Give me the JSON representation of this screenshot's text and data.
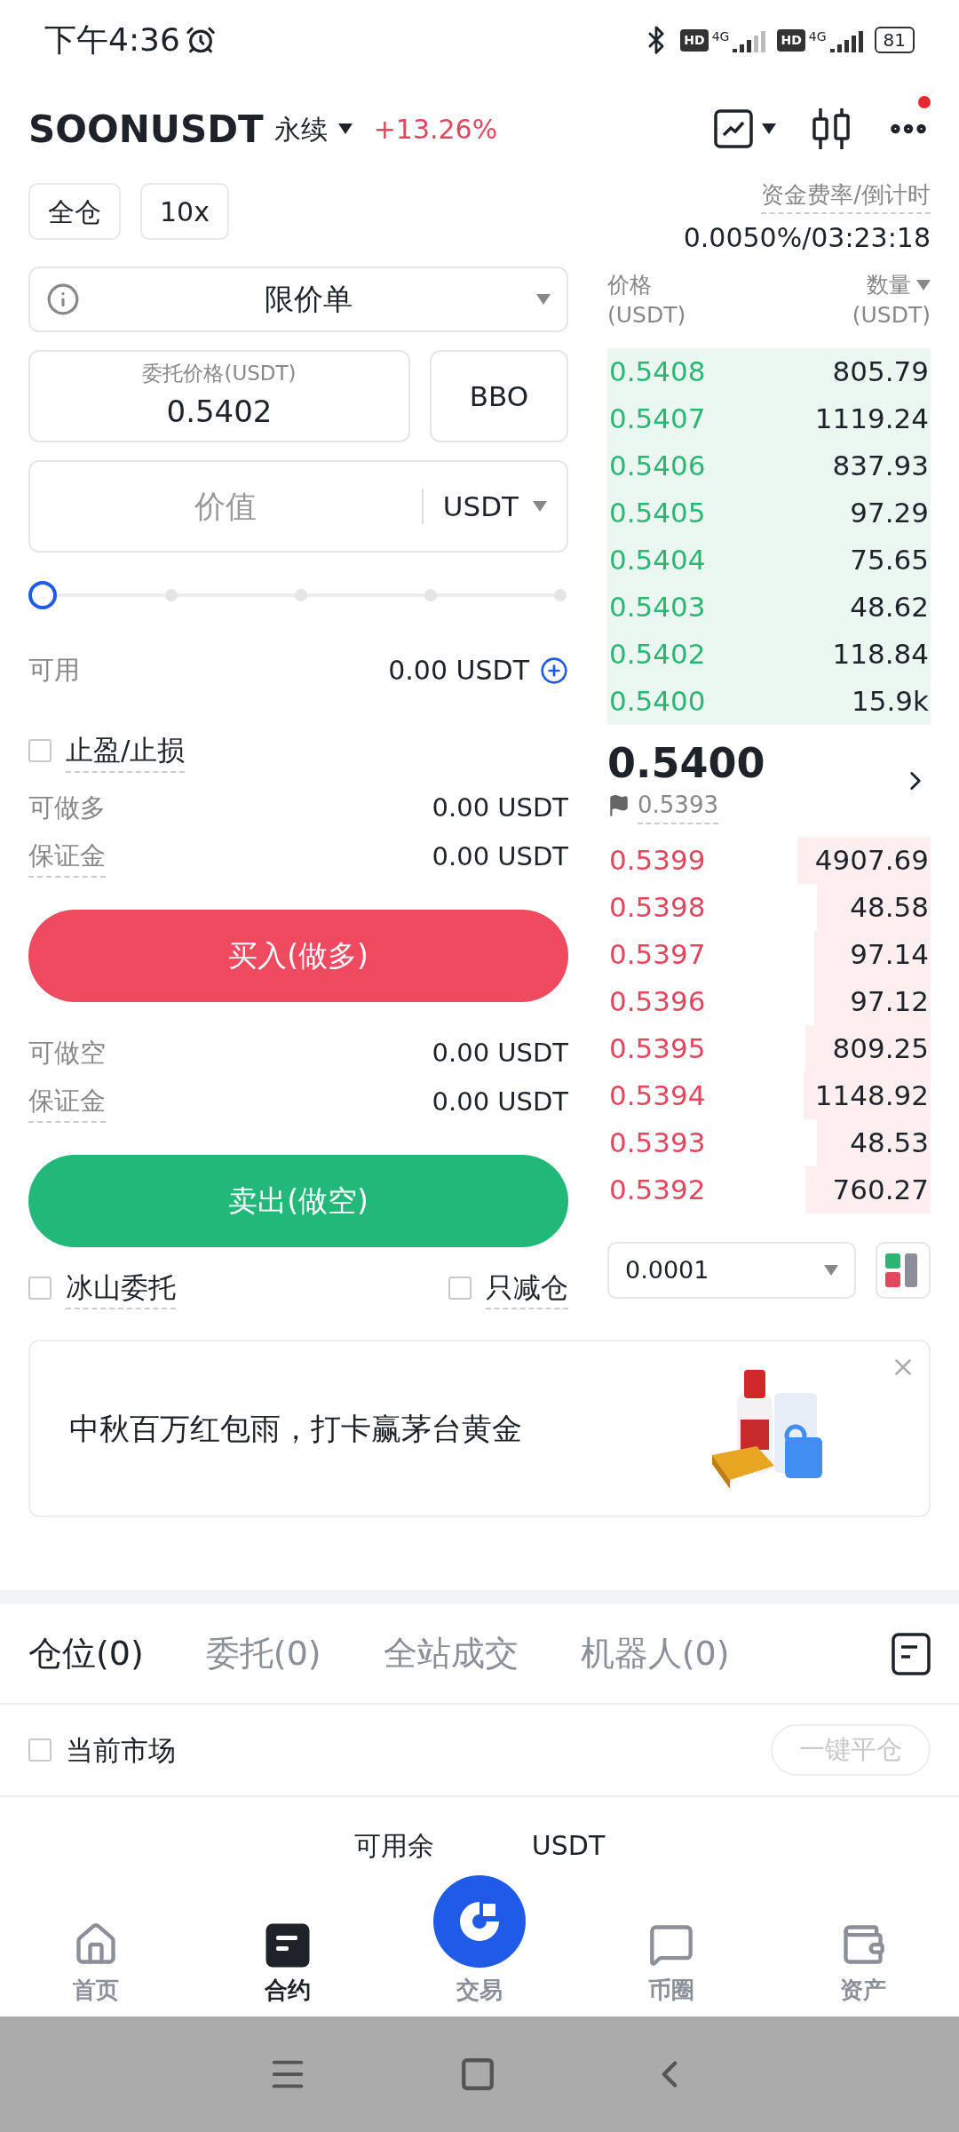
{
  "status_bar": {
    "time": "下午4:36",
    "hd_1": "HD",
    "network_1": "4G",
    "hd_2": "HD",
    "network_2": "4G",
    "battery": "81"
  },
  "header": {
    "symbol": "SOONUSDT",
    "contract_type": "永续",
    "change": "+13.26%",
    "notification_dot": true
  },
  "margin_mode": "全仓",
  "leverage": "10x",
  "funding": {
    "label": "资金费率/倒计时",
    "value": "0.0050%/03:23:18"
  },
  "order_form": {
    "order_type": "限价单",
    "price_label": "委托价格(USDT)",
    "price_value": "0.5402",
    "bbo": "BBO",
    "amount_placeholder": "价值",
    "amount_unit": "USDT",
    "slider": {
      "level": 0
    },
    "available_label": "可用",
    "available_value": "0.00 USDT",
    "tp_sl": {
      "label": "止盈/止损",
      "checked": false
    },
    "long": [
      {
        "label": "可做多",
        "value": "0.00 USDT"
      },
      {
        "label": "保证金",
        "value": "0.00 USDT"
      }
    ],
    "buy_button": "买入(做多)",
    "short": [
      {
        "label": "可做空",
        "value": "0.00 USDT"
      },
      {
        "label": "保证金",
        "value": "0.00 USDT"
      }
    ],
    "sell_button": "卖出(做空)",
    "options": [
      {
        "label": "冰山委托",
        "checked": false
      },
      {
        "label": "只减仓",
        "checked": false
      }
    ]
  },
  "order_book": {
    "price_header": "价格",
    "price_unit": "(USDT)",
    "amount_header": "数量",
    "amount_unit": "(USDT)",
    "asks": [
      {
        "price": "0.5408",
        "amount": "805.79"
      },
      {
        "price": "0.5407",
        "amount": "1119.24"
      },
      {
        "price": "0.5406",
        "amount": "837.93"
      },
      {
        "price": "0.5405",
        "amount": "97.29"
      },
      {
        "price": "0.5404",
        "amount": "75.65"
      },
      {
        "price": "0.5403",
        "amount": "48.62"
      },
      {
        "price": "0.5402",
        "amount": "118.84"
      },
      {
        "price": "0.5400",
        "amount": "15.9k"
      }
    ],
    "last_price": "0.5400",
    "mark_price": "0.5393",
    "bids": [
      {
        "price": "0.5399",
        "amount": "4907.69"
      },
      {
        "price": "0.5398",
        "amount": "48.58"
      },
      {
        "price": "0.5397",
        "amount": "97.14"
      },
      {
        "price": "0.5396",
        "amount": "97.12"
      },
      {
        "price": "0.5395",
        "amount": "809.25"
      },
      {
        "price": "0.5394",
        "amount": "1148.92"
      },
      {
        "price": "0.5393",
        "amount": "48.53"
      },
      {
        "price": "0.5392",
        "amount": "760.27"
      }
    ],
    "precision": "0.0001"
  },
  "banner": {
    "text": "中秋百万红包雨，打卡赢茅台黄金",
    "kind": "picture"
  },
  "tabs": [
    {
      "label": "仓位(0)",
      "selected": true
    },
    {
      "label": "委托(0)",
      "selected": false
    },
    {
      "label": "全站成交",
      "selected": false
    },
    {
      "label": "机器人(0)",
      "selected": false
    }
  ],
  "filter": {
    "label": "当前市场",
    "checked": false,
    "close_all": "一键平仓"
  },
  "balance_fragments": [
    "可用余",
    "USDT"
  ],
  "nav": [
    {
      "label": "首页",
      "selected": false,
      "kind": "home"
    },
    {
      "label": "合约",
      "selected": true,
      "kind": "contract"
    },
    {
      "label": "交易",
      "selected": false,
      "kind": "trade"
    },
    {
      "label": "币圈",
      "selected": false,
      "kind": "chat"
    },
    {
      "label": "资产",
      "selected": false,
      "kind": "wallet"
    }
  ]
}
